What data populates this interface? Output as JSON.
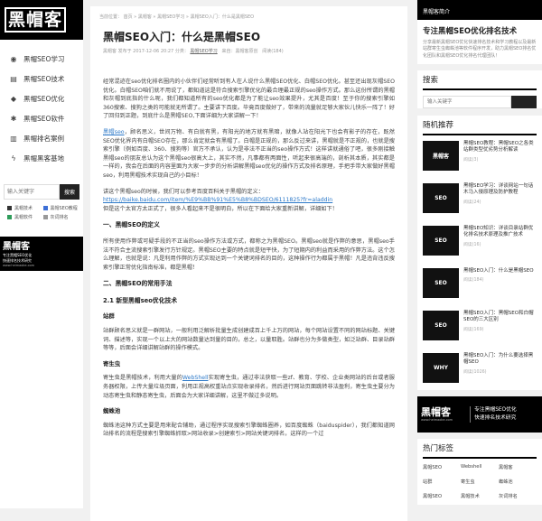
{
  "left": {
    "logo_text": "黑帽客",
    "nav": [
      {
        "icon": "eye-icon",
        "glyph": "◉",
        "label": "黑帽SEO学习"
      },
      {
        "icon": "book-icon",
        "glyph": "▤",
        "label": "黑帽SEO技术"
      },
      {
        "icon": "tag-icon",
        "glyph": "◆",
        "label": "黑帽SEO优化"
      },
      {
        "icon": "gear-icon",
        "glyph": "✱",
        "label": "黑帽SEO软件"
      },
      {
        "icon": "chart-icon",
        "glyph": "▥",
        "label": "黑帽排名案例"
      },
      {
        "icon": "bolt-icon",
        "glyph": "ϟ",
        "label": "黑帽黑客基地"
      }
    ],
    "search_placeholder": "输入关键字",
    "search_button": "搜索",
    "tags": [
      {
        "label": "黑帽技术",
        "color": "#333333"
      },
      {
        "label": "黑帽SEO教程",
        "color": "#3d6fd6"
      },
      {
        "label": "黑帽软件",
        "color": "#2e9c5a"
      },
      {
        "label": "灰词排名",
        "color": "#999999"
      }
    ],
    "banner": {
      "title": "黑帽客",
      "sub": "专注黑帽SEO优化",
      "desc": "快速排名技术研究",
      "url": "www.heimaoke.com"
    }
  },
  "article": {
    "breadcrumb": "当前位置：  首页  »  黑帽客  »  黑帽SEO学习  »  黑帽SEO入门：什么是黑帽SEO",
    "title": "黑帽SEO入门：什么是黑帽SEO",
    "meta_author_date": "黑帽客  发布于 2017-12-06 20:27   分类：",
    "meta_category": "黑帽SEO学习",
    "meta_from": "来自：黑帽客原创",
    "meta_views": "阅读(184)",
    "p1": "经常混迹在seo优化排名圈内的小伙伴们经常听到有人在人说什么黑帽SEO优化、白帽SEO优化。甚至还出现灰帽SEO优化。白帽SEO咱们就不用说了，都知道这是符合搜索引擎优化的最合理最正规的seo操作方式。那么这份所谓的黑帽和灰帽到底指的什么呢，我们都知道所有的seo优化都是为了能让seo效果提升，尤其是百度！至于你的搜索引擎如360搜索、搜狗之类的可能就无所谓了。主要讲下百度。毕竟百度做好了，带来的流量就足够大家伙儿快乐一阵了！好了回归到正题，到底什么是黑帽SEO,下面详细为大家讲解一下！",
    "p2_link": "黑帽seo",
    "p2_rest": "，顾名思义，世间万物、有白就有黑，有阳光的地方就有黑暗，就像人站在阳光下也会有影子的存在，既然SEO优化界内有白帽SEO存在，那么肯定就会有黑帽了。白帽是正规的，那么反过来讲，黑帽就是不正规的，也就是搜索引擎（例如百度、360、搜狗等）官方不承认，认为是非法不正当的seo操作方式！这样讲就通俗了吧，很多刚接触黑帽seo的朋友总认为这个黑帽seo很高大上，其实不然，凡事都有两面性，听起来很高端的，剖析其本质，其实都是一样的，我会在后面的内容里面为大家一步步的分析讲解黑帽seo优化的操作方式及排名原理，手把手带大家做好黑帽seo，利用黑帽技术实现自己的小目标！",
    "p3": "讲这个黑帽seo的时候，我们可以参考百度百科关于黑帽的定义：",
    "p3_link": "https://baike.baidu.com/item/%E9%BB%91%E5%B8%BDSEO/6111825?fr=aladdin",
    "p4": "但是这个太官方太正式了，很多人看起来不是很明白，所以在下面给大家重新讲解，详细如下！",
    "h1": "一、黑帽SEO的定义",
    "p5": "所有使用作弊或可疑手段的不正当的seo操作方法或方式，都称之为黑帽SEO。黑帽seo就是作弊的意思，黑帽seo手法不符合主流搜索引擎发行方针规定。黑帽SEO主要的特点就是短平快，为了短期内的利益而采用的作弊方法。这个怎么理解，也就是说：凡是利用作弊的方式实现达到一个关键词排名的目的，这种操作行为都属于黑帽！凡是违背违反搜索引擎正常优化指南标准，都是黑帽！",
    "h2": "二、黑帽SEO的常用手法",
    "h3": "2.1 新型黑帽seo优化技术",
    "h4a": "站群",
    "p6": "站群顾名思义就是一群网站，一般利用泛解析批量生成创建成百上千上万的网站，每个网站设置不同的网站标题、关键词、描述等，实现一个以上大的网站数量达到量的目的，总之，以量取胜。站群也分为多做类型，如泛站群、目录站群等等，后面会详细讲解站群的操作模式。",
    "h4b": "寄生虫",
    "p7_a": "寄生虫是黑帽技术，利用大量的",
    "p7_link": "WebShell",
    "p7_b": "实现寄生虫，通过非法获取一些zf、教育、学校、企业类网站的后台或者服务器权限，上传大量垃圾页面，利用正规高权重站点实现收录排名，然后进行网站页面跳转非法盈利，寄生虫主要分为动态寄生虫和静态寄生虫，后面会为大家详细讲解，这里不做过多说明。",
    "h4c": "蜘蛛池",
    "p8": "蜘蛛池这种方式主要是用来配合辅助，通过程序实现搜索引擎蜘蛛圈养，如百度蜘蛛（baiduspider），我们都知道网站排名的流程是搜索引擎蜘蛛抓取>网站收录>创建索引>网站关键词排名，这样的一个过"
  },
  "right": {
    "intro_header": "黑帽客简介",
    "intro_title": "专注黑帽SEO优化排名技术",
    "intro_body": "分享最新黑帽SEO优化快速排名技术和学习教程以及最新站群寄生虫蜘蛛池等软件程序开发，助力黑帽SEO排名优化团队和黑帽SEO优化排名代理团队！",
    "search_title": "搜索",
    "search_placeholder": "输入关键字",
    "rec_title": "随机推荐",
    "rec": [
      {
        "thumb": "黑帽客",
        "title": "黑帽SEO教程：黑帽SEO之各类站群类型优劣势分析解读",
        "views": "阅读(3)"
      },
      {
        "thumb": "SEO",
        "title": "黑帽SEO学习：详谈网站一句话木马入侵原理及防护教程",
        "views": "阅读(24)"
      },
      {
        "thumb": "SEO",
        "title": "黑帽SEO知识：详谈目录站群优化排名技术原理及推广技术",
        "views": "阅读(16)"
      },
      {
        "thumb": "SEO",
        "title": "黑帽SEO入门：什么是黑帽SEO",
        "views": "阅读(184)"
      },
      {
        "thumb": "SEO",
        "title": "黑帽SEO入门：黑帽SEO和白帽SEO的三大区别",
        "views": "阅读(169)"
      },
      {
        "thumb": "WHY",
        "title": "黑帽SEO入门：为什么要选择黑帽SEO",
        "views": "阅读(1026)"
      }
    ],
    "banner": {
      "title": "黑帽客",
      "url": "www.heimaoke.com",
      "line1": "专注黑帽SEO优化",
      "line2": "快速排名技术研究"
    },
    "hot_title": "热门标签",
    "hot_tags": [
      "黑帽SEO",
      "Webshell",
      "黑帽客",
      "站群",
      "寄生虫",
      "蜘蛛池",
      "黑帽SEO",
      "黑帽技术",
      "灰词排名"
    ]
  }
}
